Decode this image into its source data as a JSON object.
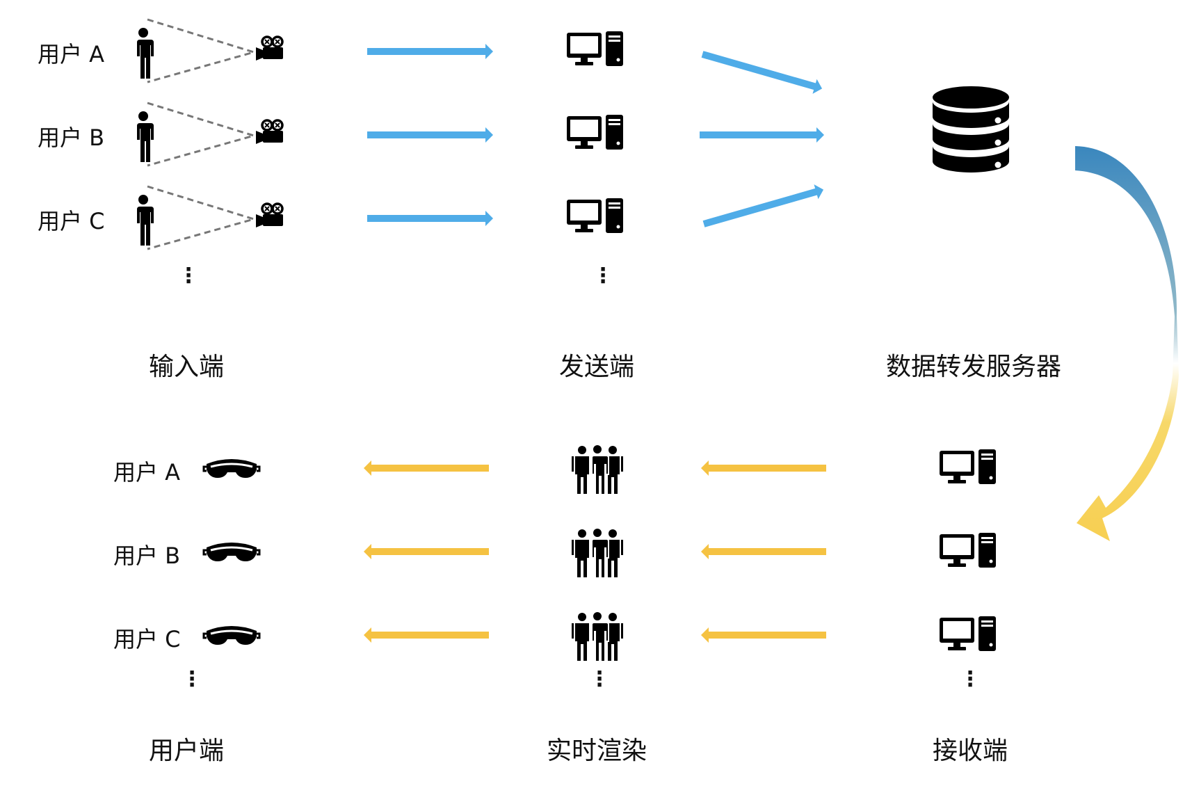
{
  "colors": {
    "send_arrow": "#4FACE8",
    "return_arrow": "#F5C242",
    "curve_top": "#3A87BE",
    "curve_bottom": "#F7CF52",
    "icon": "#000000",
    "sight_line": "#777777"
  },
  "top_rows": [
    {
      "user_label": "用户 A",
      "icons": [
        "person-icon",
        "camera-icon",
        "computer-icon"
      ]
    },
    {
      "user_label": "用户 B",
      "icons": [
        "person-icon",
        "camera-icon",
        "computer-icon"
      ]
    },
    {
      "user_label": "用户 C",
      "icons": [
        "person-icon",
        "camera-icon",
        "computer-icon"
      ]
    }
  ],
  "bottom_rows": [
    {
      "user_label": "用户 A",
      "icons": [
        "vr-headset-icon",
        "group-icon",
        "computer-icon"
      ]
    },
    {
      "user_label": "用户 B",
      "icons": [
        "vr-headset-icon",
        "group-icon",
        "computer-icon"
      ]
    },
    {
      "user_label": "用户 C",
      "icons": [
        "vr-headset-icon",
        "group-icon",
        "computer-icon"
      ]
    }
  ],
  "stages": {
    "input": "输入端",
    "sender": "发送端",
    "server": "数据转发服务器",
    "user": "用户端",
    "render": "实时渲染",
    "receiver": "接收端"
  },
  "ellipsis": "⋮",
  "server_icon": "database-icon"
}
